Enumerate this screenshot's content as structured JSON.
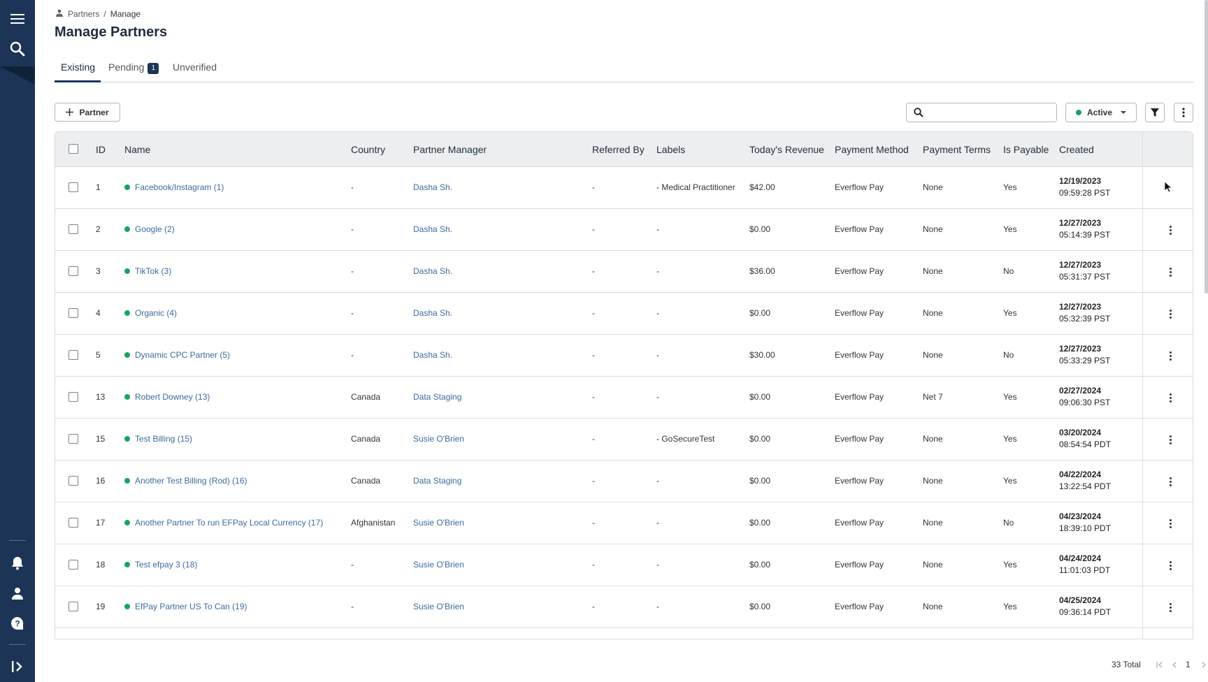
{
  "breadcrumb": {
    "root": "Partners",
    "separator": "/",
    "current": "Manage"
  },
  "page_title": "Manage Partners",
  "tabs": [
    {
      "label": "Existing",
      "active": true
    },
    {
      "label": "Pending",
      "badge": "1",
      "active": false
    },
    {
      "label": "Unverified",
      "active": false
    }
  ],
  "toolbar": {
    "add_partner_label": "Partner",
    "search_placeholder": "",
    "status_filter": "Active",
    "status_color": "#1aa260"
  },
  "table": {
    "columns": [
      "ID",
      "Name",
      "Country",
      "Partner Manager",
      "Referred By",
      "Labels",
      "Today's Revenue",
      "Payment Method",
      "Payment Terms",
      "Is Payable",
      "Created"
    ],
    "rows": [
      {
        "id": "1",
        "name": "Facebook/Instagram (1)",
        "country": "-",
        "manager": "Dasha Sh.",
        "referred": "-",
        "labels": "- Medical Practitioner",
        "revenue": "$42.00",
        "method": "Everflow Pay",
        "terms": "None",
        "payable": "Yes",
        "date": "12/19/2023",
        "time": "09:59:28 PST"
      },
      {
        "id": "2",
        "name": "Google (2)",
        "country": "-",
        "manager": "Dasha Sh.",
        "referred": "-",
        "labels": "-",
        "revenue": "$0.00",
        "method": "Everflow Pay",
        "terms": "None",
        "payable": "Yes",
        "date": "12/27/2023",
        "time": "05:14:39 PST"
      },
      {
        "id": "3",
        "name": "TikTok (3)",
        "country": "-",
        "manager": "Dasha Sh.",
        "referred": "-",
        "labels": "-",
        "revenue": "$36.00",
        "method": "Everflow Pay",
        "terms": "None",
        "payable": "No",
        "date": "12/27/2023",
        "time": "05:31:37 PST"
      },
      {
        "id": "4",
        "name": "Organic (4)",
        "country": "-",
        "manager": "Dasha Sh.",
        "referred": "-",
        "labels": "-",
        "revenue": "$0.00",
        "method": "Everflow Pay",
        "terms": "None",
        "payable": "Yes",
        "date": "12/27/2023",
        "time": "05:32:39 PST"
      },
      {
        "id": "5",
        "name": "Dynamic CPC Partner (5)",
        "country": "-",
        "manager": "Dasha Sh.",
        "referred": "-",
        "labels": "-",
        "revenue": "$30.00",
        "method": "Everflow Pay",
        "terms": "None",
        "payable": "No",
        "date": "12/27/2023",
        "time": "05:33:29 PST"
      },
      {
        "id": "13",
        "name": "Robert Downey (13)",
        "country": "Canada",
        "manager": "Data Staging",
        "referred": "-",
        "labels": "-",
        "revenue": "$0.00",
        "method": "Everflow Pay",
        "terms": "Net 7",
        "payable": "Yes",
        "date": "02/27/2024",
        "time": "09:06:30 PST"
      },
      {
        "id": "15",
        "name": "Test Billing (15)",
        "country": "Canada",
        "manager": "Susie O'Brien",
        "referred": "-",
        "labels": "- GoSecureTest",
        "revenue": "$0.00",
        "method": "Everflow Pay",
        "terms": "None",
        "payable": "Yes",
        "date": "03/20/2024",
        "time": "08:54:54 PDT"
      },
      {
        "id": "16",
        "name": "Another Test Billing (Rod) (16)",
        "country": "Canada",
        "manager": "Data Staging",
        "referred": "-",
        "labels": "-",
        "revenue": "$0.00",
        "method": "Everflow Pay",
        "terms": "None",
        "payable": "Yes",
        "date": "04/22/2024",
        "time": "13:22:54 PDT"
      },
      {
        "id": "17",
        "name": "Another Partner To run EFPay Local Currency (17)",
        "country": "Afghanistan",
        "manager": "Susie O'Brien",
        "referred": "-",
        "labels": "-",
        "revenue": "$0.00",
        "method": "Everflow Pay",
        "terms": "None",
        "payable": "No",
        "date": "04/23/2024",
        "time": "18:39:10 PDT"
      },
      {
        "id": "18",
        "name": "Test efpay 3 (18)",
        "country": "-",
        "manager": "Susie O'Brien",
        "referred": "-",
        "labels": "-",
        "revenue": "$0.00",
        "method": "Everflow Pay",
        "terms": "None",
        "payable": "Yes",
        "date": "04/24/2024",
        "time": "11:01:03 PDT"
      },
      {
        "id": "19",
        "name": "EfPay Partner US To Can (19)",
        "country": "-",
        "manager": "Susie O'Brien",
        "referred": "-",
        "labels": "-",
        "revenue": "$0.00",
        "method": "Everflow Pay",
        "terms": "None",
        "payable": "Yes",
        "date": "04/25/2024",
        "time": "09:36:14 PDT"
      }
    ]
  },
  "pagination": {
    "total": "33 Total",
    "current_page": "1"
  }
}
